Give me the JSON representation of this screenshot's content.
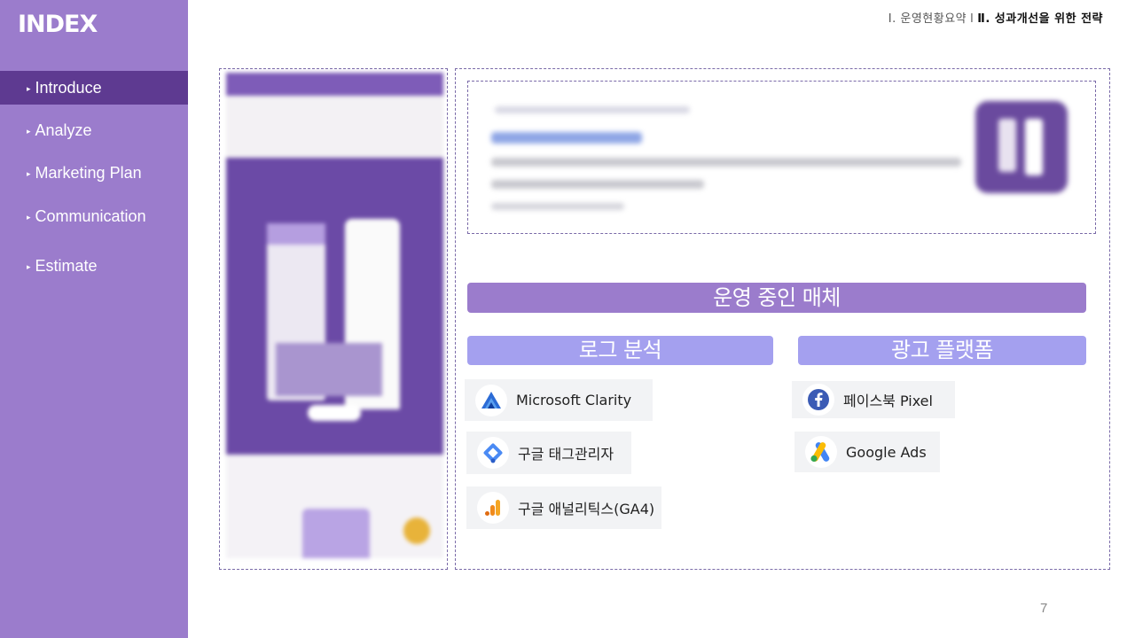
{
  "sidebar": {
    "title": "INDEX",
    "items": [
      {
        "label": "Introduce",
        "active": true
      },
      {
        "label": "Analyze",
        "active": false
      },
      {
        "label": "Marketing Plan",
        "active": false
      },
      {
        "label": "Communication",
        "active": false
      },
      {
        "label": "Estimate",
        "active": false
      }
    ],
    "arrow_glyph": "▸"
  },
  "breadcrumb": {
    "part1": "Ⅰ. 운영현황요약",
    "separator": "l",
    "part2": "Ⅱ. 성과개선을 위한 전략"
  },
  "main": {
    "section_title": "운영 중인 매체",
    "log_analysis": {
      "title": "로그 분석",
      "tools": [
        {
          "name": "Microsoft Clarity",
          "icon": "microsoft-clarity-icon"
        },
        {
          "name": "구글 태그관리자",
          "icon": "google-tag-manager-icon"
        },
        {
          "name": "구글 애널리틱스(GA4)",
          "icon": "google-analytics-icon"
        }
      ]
    },
    "ad_platform": {
      "title": "광고 플랫폼",
      "tools": [
        {
          "name": "페이스북 Pixel",
          "icon": "facebook-icon"
        },
        {
          "name": "Google Ads",
          "icon": "google-ads-icon"
        }
      ]
    }
  },
  "page_number": "7",
  "colors": {
    "sidebar_bg": "#9b7ccc",
    "sidebar_active": "#5e3a91",
    "section_header": "#9b7ccc",
    "sub_header": "#a4a0ef",
    "tool_bg": "#f2f3f5"
  }
}
